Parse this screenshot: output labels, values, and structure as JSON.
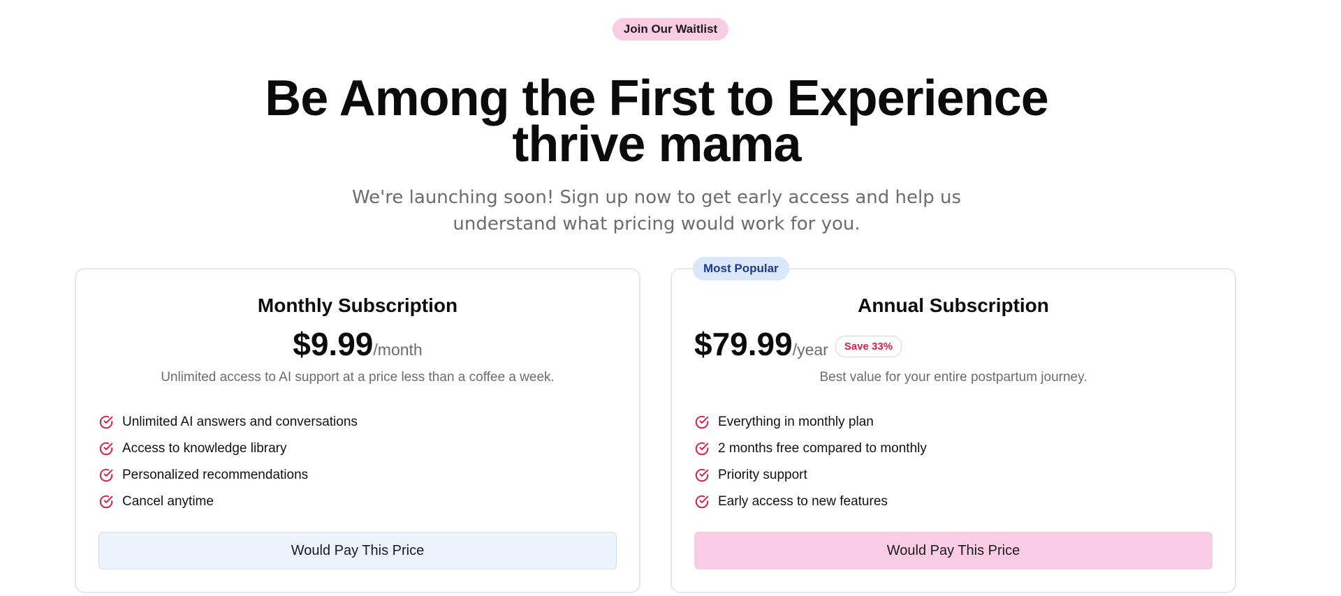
{
  "header": {
    "badge": "Join Our Waitlist",
    "title_line1": "Be Among the First to Experience",
    "title_line2": "thrive mama",
    "subtitle_line1": "We're launching soon! Sign up now to get early access and help us",
    "subtitle_line2": "understand what pricing would work for you."
  },
  "plans": {
    "monthly": {
      "title": "Monthly Subscription",
      "price": "$9.99",
      "period": "/month",
      "description": "Unlimited access to AI support at a price less than a coffee a week.",
      "features": [
        "Unlimited AI answers and conversations",
        "Access to knowledge library",
        "Personalized recommendations",
        "Cancel anytime"
      ],
      "cta": "Would Pay This Price"
    },
    "annual": {
      "badge": "Most Popular",
      "title": "Annual Subscription",
      "price": "$79.99",
      "period": "/year",
      "save_badge": "Save 33%",
      "description": "Best value for your entire postpartum journey.",
      "features": [
        "Everything in monthly plan",
        "2 months free compared to monthly",
        "Priority support",
        "Early access to new features"
      ],
      "cta": "Would Pay This Price"
    }
  },
  "colors": {
    "accent_pink": "#f9cce3",
    "check_red": "#d3214c",
    "popular_blue_bg": "#dbe7fb",
    "popular_blue_text": "#1f3a8a",
    "muted_text": "#6b6b72"
  },
  "icons": {
    "feature_check": "check-circle-icon"
  }
}
